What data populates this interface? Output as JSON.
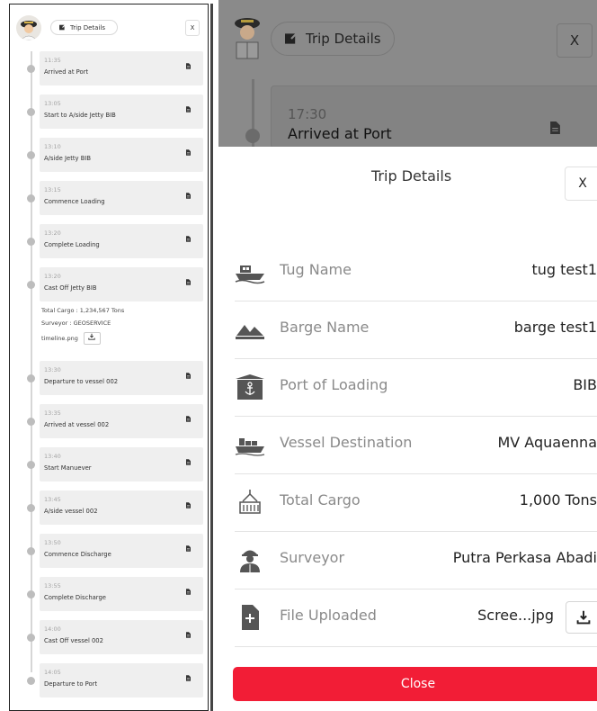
{
  "left": {
    "header": {
      "title": "Trip Details",
      "close": "X"
    },
    "timeline": [
      {
        "time": "11:35",
        "label": "Arrived at Port"
      },
      {
        "time": "13:05",
        "label": "Start to A/side Jetty BIB"
      },
      {
        "time": "13:10",
        "label": "A/side Jetty BIB"
      },
      {
        "time": "13:15",
        "label": "Commence Loading"
      },
      {
        "time": "13:20",
        "label": "Complete Loading"
      },
      {
        "time": "13:20",
        "label": "Cast Off Jetty BIB"
      },
      {
        "time": "13:30",
        "label": "Departure to vessel 002"
      },
      {
        "time": "13:35",
        "label": "Arrived at vessel 002"
      },
      {
        "time": "13:40",
        "label": "Start Manuever"
      },
      {
        "time": "13:45",
        "label": "A/side vessel 002"
      },
      {
        "time": "13:50",
        "label": "Commence Discharge"
      },
      {
        "time": "13:55",
        "label": "Complete Discharge"
      },
      {
        "time": "14:00",
        "label": "Cast Off vessel 002"
      },
      {
        "time": "14:05",
        "label": "Departure to Port"
      }
    ],
    "extra": {
      "total_cargo": "Total Cargo : 1,234,567 Tons",
      "surveyor": "Surveyor : GEOSERVICE",
      "file": "timeline.png"
    }
  },
  "right": {
    "background": {
      "title": "Trip Details",
      "close": "X",
      "card_time": "17:30",
      "card_label": "Arrived at Port"
    },
    "modal": {
      "title": "Trip Details",
      "close": "X",
      "rows": [
        {
          "icon": "tug-boat-icon",
          "label": "Tug Name",
          "value": "tug test1"
        },
        {
          "icon": "barge-icon",
          "label": "Barge Name",
          "value": "barge test1"
        },
        {
          "icon": "anchor-port-icon",
          "label": "Port of Loading",
          "value": "BIB"
        },
        {
          "icon": "vessel-ship-icon",
          "label": "Vessel Destination",
          "value": "MV Aquaenna"
        },
        {
          "icon": "cargo-crane-icon",
          "label": "Total Cargo",
          "value": "1,000 Tons"
        },
        {
          "icon": "surveyor-worker-icon",
          "label": "Surveyor",
          "value": "Putra Perkasa Abadi"
        },
        {
          "icon": "file-add-icon",
          "label": "File Uploaded",
          "value": "Scree...jpg"
        }
      ],
      "close_button": "Close"
    }
  },
  "colors": {
    "accent_red": "#f21d36",
    "overlay_gray": "#8a8a8a",
    "card_gray": "#efefef",
    "icon_dark": "#555555"
  }
}
